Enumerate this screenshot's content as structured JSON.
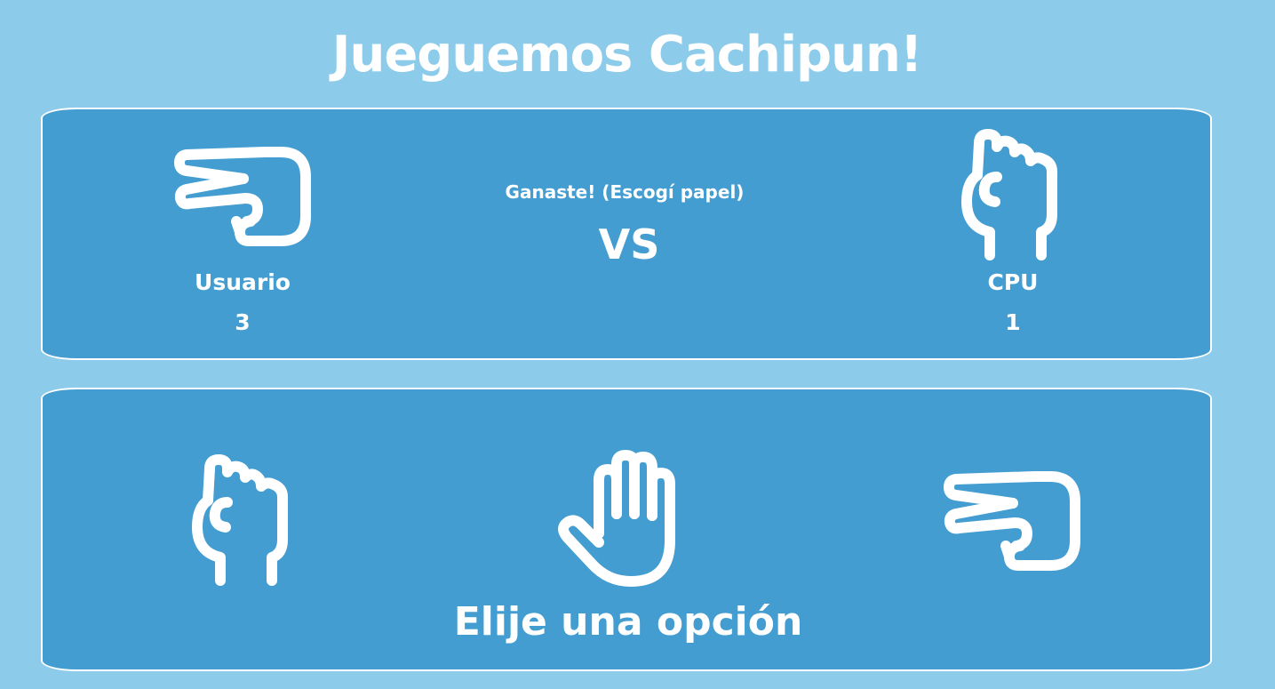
{
  "title": "Jueguemos Cachipun!",
  "scoreboard": {
    "status": "Ganaste! (Escogí papel)",
    "vs_label": "VS",
    "user": {
      "label": "Usuario",
      "score": "3",
      "choice_icon": "scissors-hand-icon"
    },
    "cpu": {
      "label": "CPU",
      "score": "1",
      "choice_icon": "rock-fist-icon"
    }
  },
  "choices": {
    "prompt": "Elije una opción",
    "options": [
      {
        "name": "rock",
        "icon": "rock-fist-icon"
      },
      {
        "name": "paper",
        "icon": "paper-hand-icon"
      },
      {
        "name": "scissors",
        "icon": "scissors-hand-icon"
      }
    ]
  },
  "colors": {
    "background": "#8ccbea",
    "panel": "#449dd1",
    "foreground": "#ffffff"
  }
}
